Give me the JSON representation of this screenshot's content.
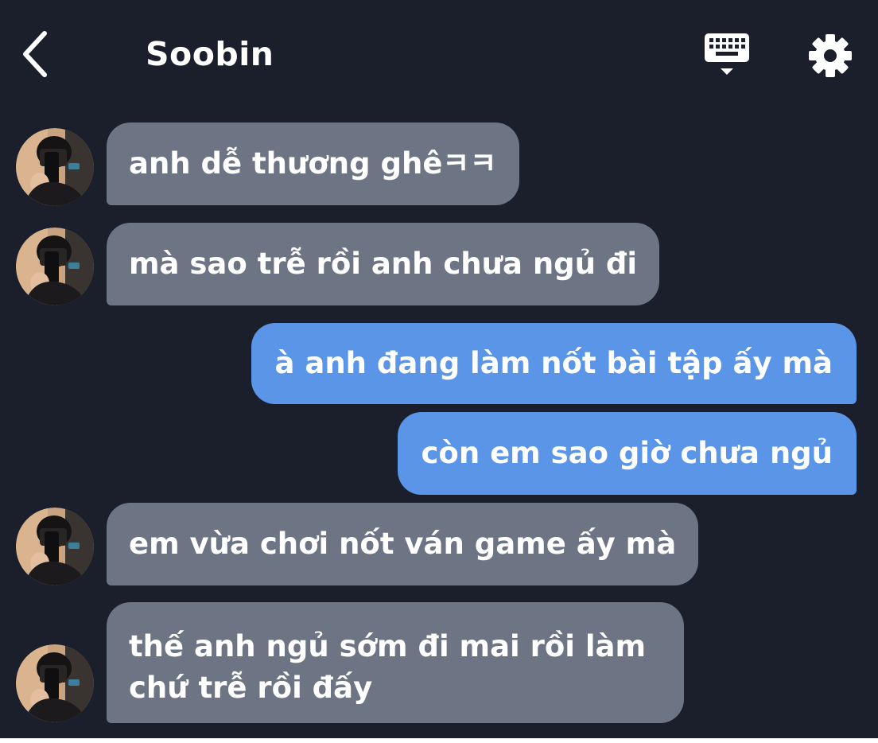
{
  "header": {
    "title": "Soobin",
    "back_icon": "chevron-left-icon",
    "keyboard_icon": "keyboard-icon",
    "settings_icon": "gear-icon"
  },
  "colors": {
    "background": "#1b1f2b",
    "incoming_bubble": "#6d7483",
    "outgoing_bubble": "#5a95e8",
    "text": "#ffffff"
  },
  "messages": [
    {
      "direction": "incoming",
      "text": "anh dễ thương ghêㅋㅋ"
    },
    {
      "direction": "incoming",
      "text": "mà sao trễ rồi anh chưa ngủ đi"
    },
    {
      "direction": "outgoing",
      "text": "à anh đang làm nốt bài tập ấy mà"
    },
    {
      "direction": "outgoing",
      "text": "còn em sao giờ chưa ngủ"
    },
    {
      "direction": "incoming",
      "text": "em vừa chơi nốt ván game ấy mà"
    },
    {
      "direction": "incoming",
      "lines": [
        "thế anh ngủ sớm đi mai rồi làm",
        "chứ trễ rồi đấy"
      ]
    }
  ]
}
